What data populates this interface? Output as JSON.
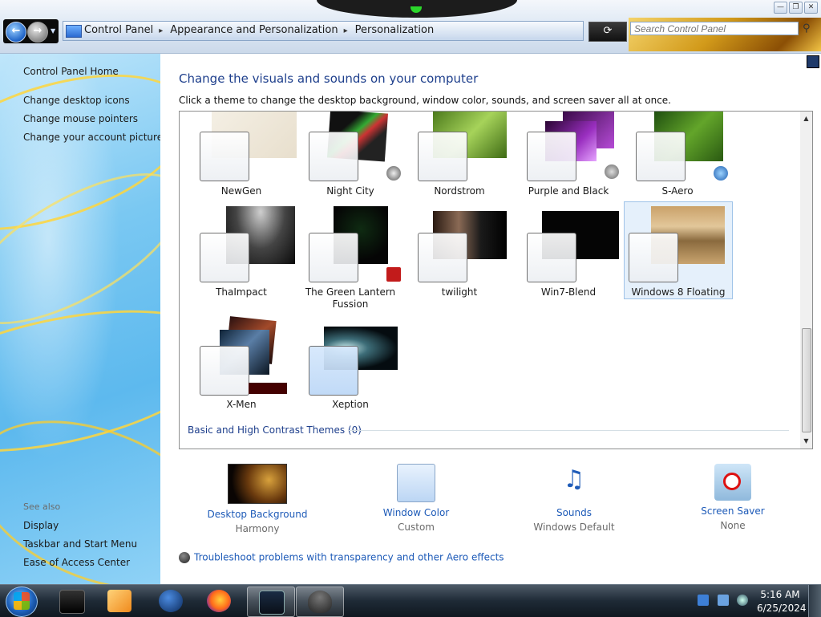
{
  "window": {
    "controls": {
      "minimize": "—",
      "maximize": "❐",
      "close": "✕"
    }
  },
  "nav": {
    "back_icon": "back-arrow-icon",
    "forward_icon": "forward-arrow-icon"
  },
  "address": {
    "crumbs": [
      "Control Panel",
      "Appearance and Personalization",
      "Personalization"
    ]
  },
  "search": {
    "placeholder": "Search Control Panel"
  },
  "sidebar": {
    "home": "Control Panel Home",
    "links": [
      "Change desktop icons",
      "Change mouse pointers",
      "Change your account picture"
    ],
    "see_also_heading": "See also",
    "see_also": [
      "Display",
      "Taskbar and Start Menu",
      "Ease of Access Center"
    ]
  },
  "main": {
    "title": "Change the visuals and sounds on your computer",
    "subtitle": "Click a theme to change the desktop background, window color, sounds, and screen saver all at once.",
    "themes": [
      {
        "name": "NewGen"
      },
      {
        "name": "Night City"
      },
      {
        "name": "Nordstrom"
      },
      {
        "name": "Purple and Black"
      },
      {
        "name": "S-Aero"
      },
      {
        "name": "ThaImpact"
      },
      {
        "name": "The Green Lantern Fussion"
      },
      {
        "name": "twilight"
      },
      {
        "name": "Win7-Blend"
      },
      {
        "name": "Windows 8 Floating"
      },
      {
        "name": "X-Men"
      },
      {
        "name": "Xeption"
      }
    ],
    "selected_theme": "Windows 8 Floating",
    "contrast_link": "Basic and High Contrast Themes (0)",
    "settings": [
      {
        "label": "Desktop Background",
        "value": "Harmony"
      },
      {
        "label": "Window Color",
        "value": "Custom"
      },
      {
        "label": "Sounds",
        "value": "Windows Default"
      },
      {
        "label": "Screen Saver",
        "value": "None"
      }
    ],
    "trouble_link": "Troubleshoot problems with transparency and other Aero effects"
  },
  "taskbar": {
    "time": "5:16 AM",
    "date": "6/25/2024"
  },
  "colors": {
    "link": "#1e5bb8",
    "title": "#1e3f8c",
    "selection": "#e5f0fb"
  }
}
